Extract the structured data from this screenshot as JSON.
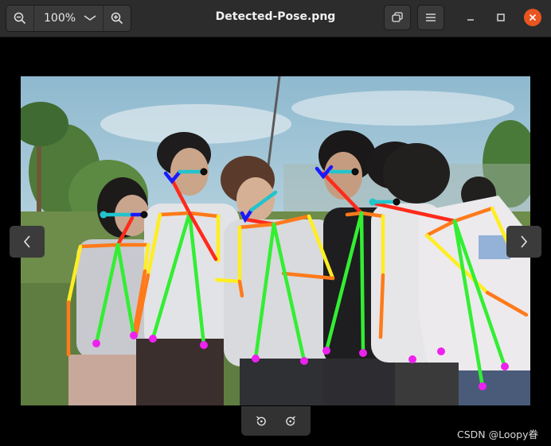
{
  "toolbar": {
    "zoom_out_icon": "zoom-out-icon",
    "zoom_level": "100%",
    "zoom_menu_icon": "chevron-down-icon",
    "zoom_in_icon": "zoom-in-icon"
  },
  "window": {
    "title": "Detected-Pose.png",
    "view_mode_icon": "copy-window-icon",
    "menu_icon": "hamburger-icon",
    "minimize_icon": "minimize-icon",
    "maximize_icon": "maximize-icon",
    "close_icon": "close-icon",
    "close_color": "#e95420"
  },
  "navigation": {
    "prev_icon": "chevron-left-icon",
    "next_icon": "chevron-right-icon"
  },
  "rotate": {
    "left_icon": "rotate-left-icon",
    "right_icon": "rotate-right-icon"
  },
  "watermark": "CSDN @Loopy眷",
  "skeleton_colors": {
    "neck": "#ff2a1a",
    "right_arm": "#ff7a1a",
    "left_arm": "#ffee22",
    "legs": "#33ee33",
    "head": "#1a1aff",
    "eyes": "#22c4cc",
    "joints": "#ee22ee"
  }
}
